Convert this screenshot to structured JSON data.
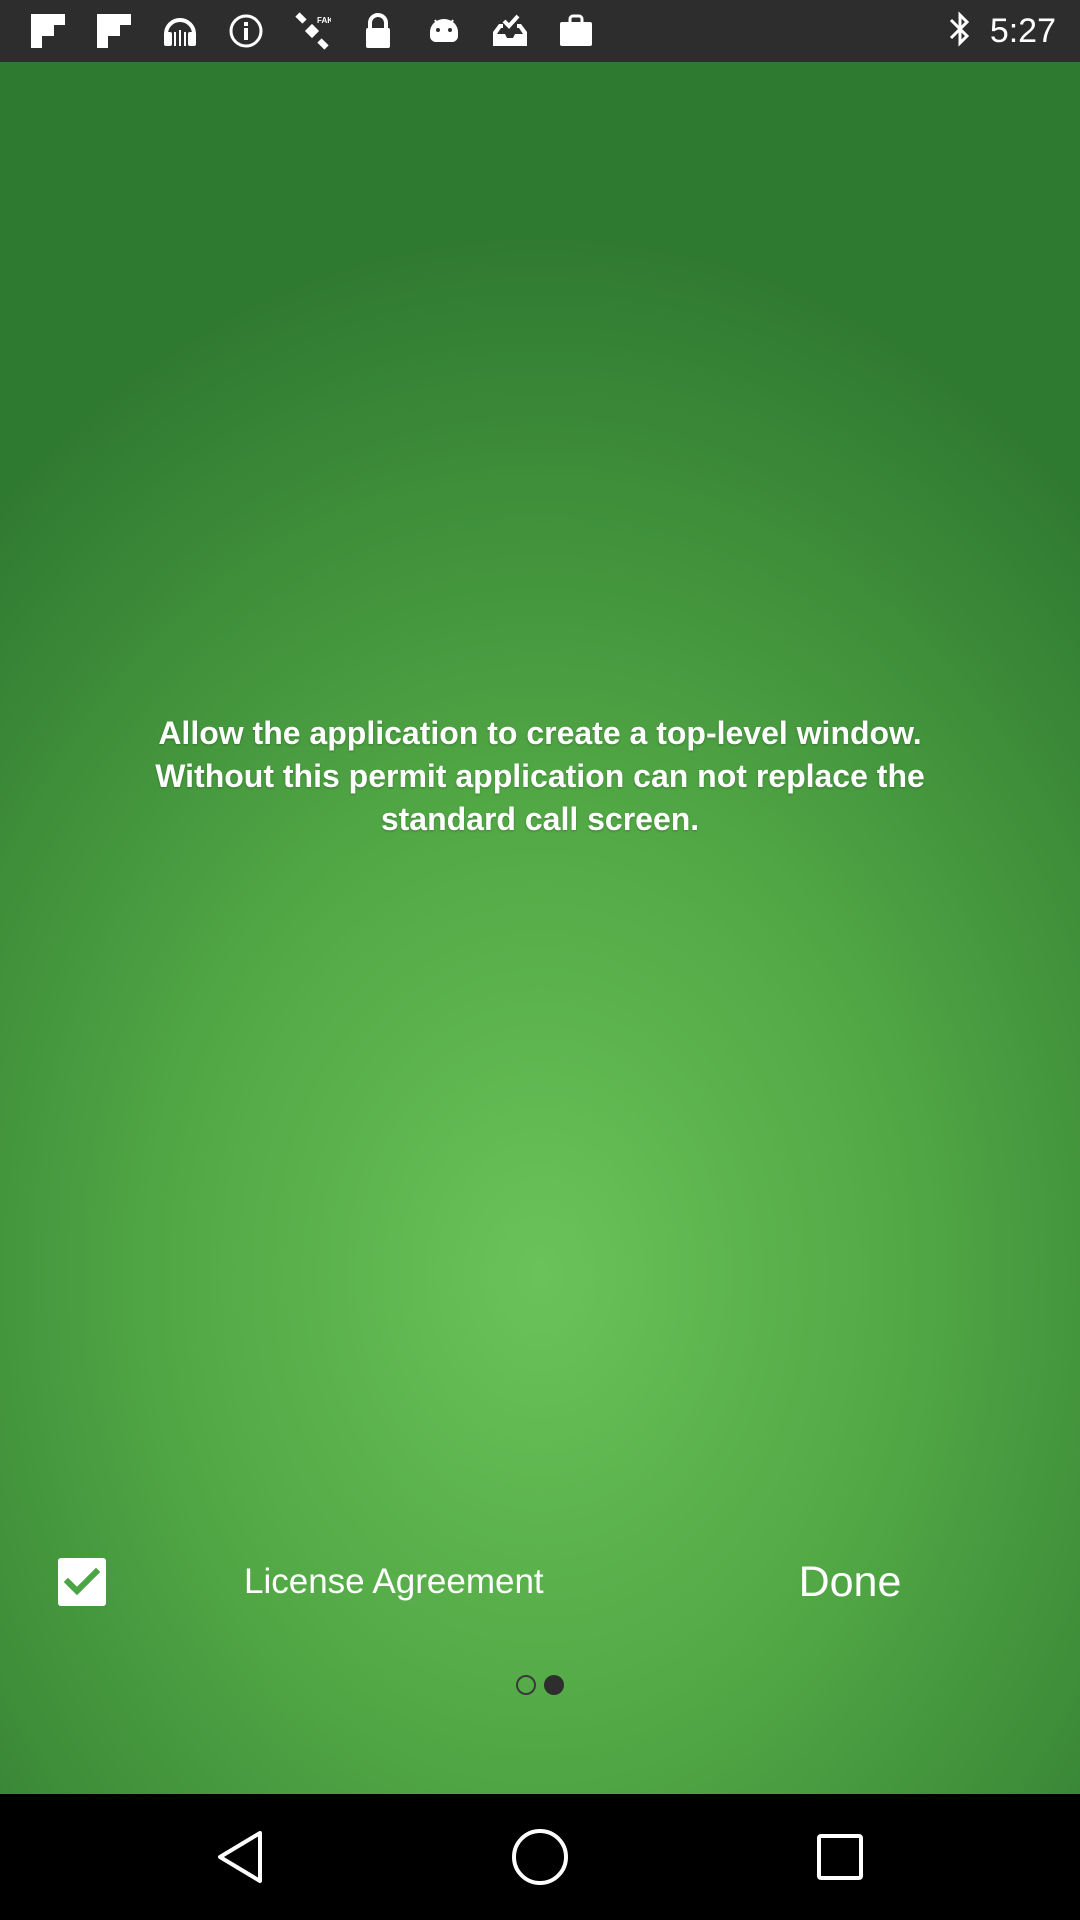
{
  "status_bar": {
    "time": "5:27",
    "icons_left": [
      "flipboard-icon",
      "flipboard-icon",
      "headphones-icon",
      "info-icon",
      "satellite-icon",
      "lock-icon",
      "android-icon",
      "inbox-check-icon",
      "shopping-bag-icon"
    ],
    "icons_right": [
      "bluetooth-icon"
    ]
  },
  "main": {
    "message": "Allow the application to create a top-level window. Without this permit application can not replace the standard call screen.",
    "license_label": "License Agreement",
    "license_checked": true,
    "done_label": "Done",
    "page_indicator": {
      "count": 2,
      "active_index": 1
    }
  },
  "nav_bar": {
    "buttons": [
      "back-icon",
      "home-icon",
      "recents-icon"
    ]
  },
  "colors": {
    "background_center": "#6ac35a",
    "background_edge": "#2f7a31",
    "status_bar": "#2d2d2d",
    "nav_bar": "#000000",
    "text": "#ffffff"
  }
}
